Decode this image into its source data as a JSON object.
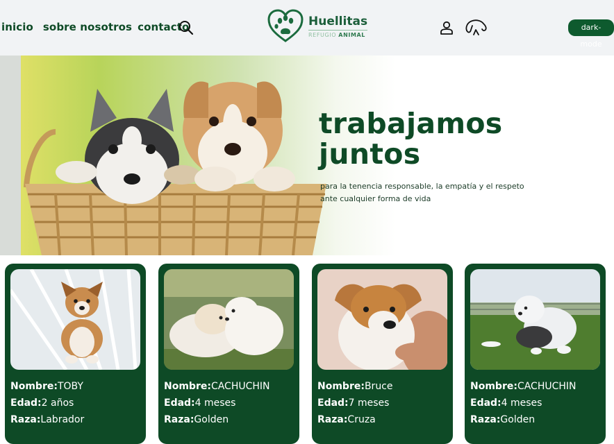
{
  "nav": {
    "links": [
      "inicio",
      "sobre nosotros",
      "contacto"
    ],
    "dark_mode_label": "dark-mode"
  },
  "logo": {
    "title": "Huellitas",
    "subtitle_part1": "REFUGIO",
    "subtitle_part2": "ANIMAL"
  },
  "hero": {
    "title_line1": "trabajamos",
    "title_line2": "juntos",
    "subtitle": "para la tenencia responsable, la empatía y el respeto ante cualquier forma de vida"
  },
  "cards": {
    "name_label": "Nombre:",
    "age_label": "Edad:",
    "breed_label": "Raza:",
    "items": [
      {
        "name": "TOBY",
        "age": "2 años",
        "breed": "Labrador"
      },
      {
        "name": "CACHUCHIN",
        "age": "4 meses",
        "breed": "Golden"
      },
      {
        "name": "Bruce",
        "age": "7 meses",
        "breed": "Cruza"
      },
      {
        "name": "CACHUCHIN",
        "age": "4 meses",
        "breed": "Golden"
      }
    ]
  },
  "colors": {
    "brand_green": "#0e4a26",
    "nav_bg": "#f1f3f5"
  }
}
